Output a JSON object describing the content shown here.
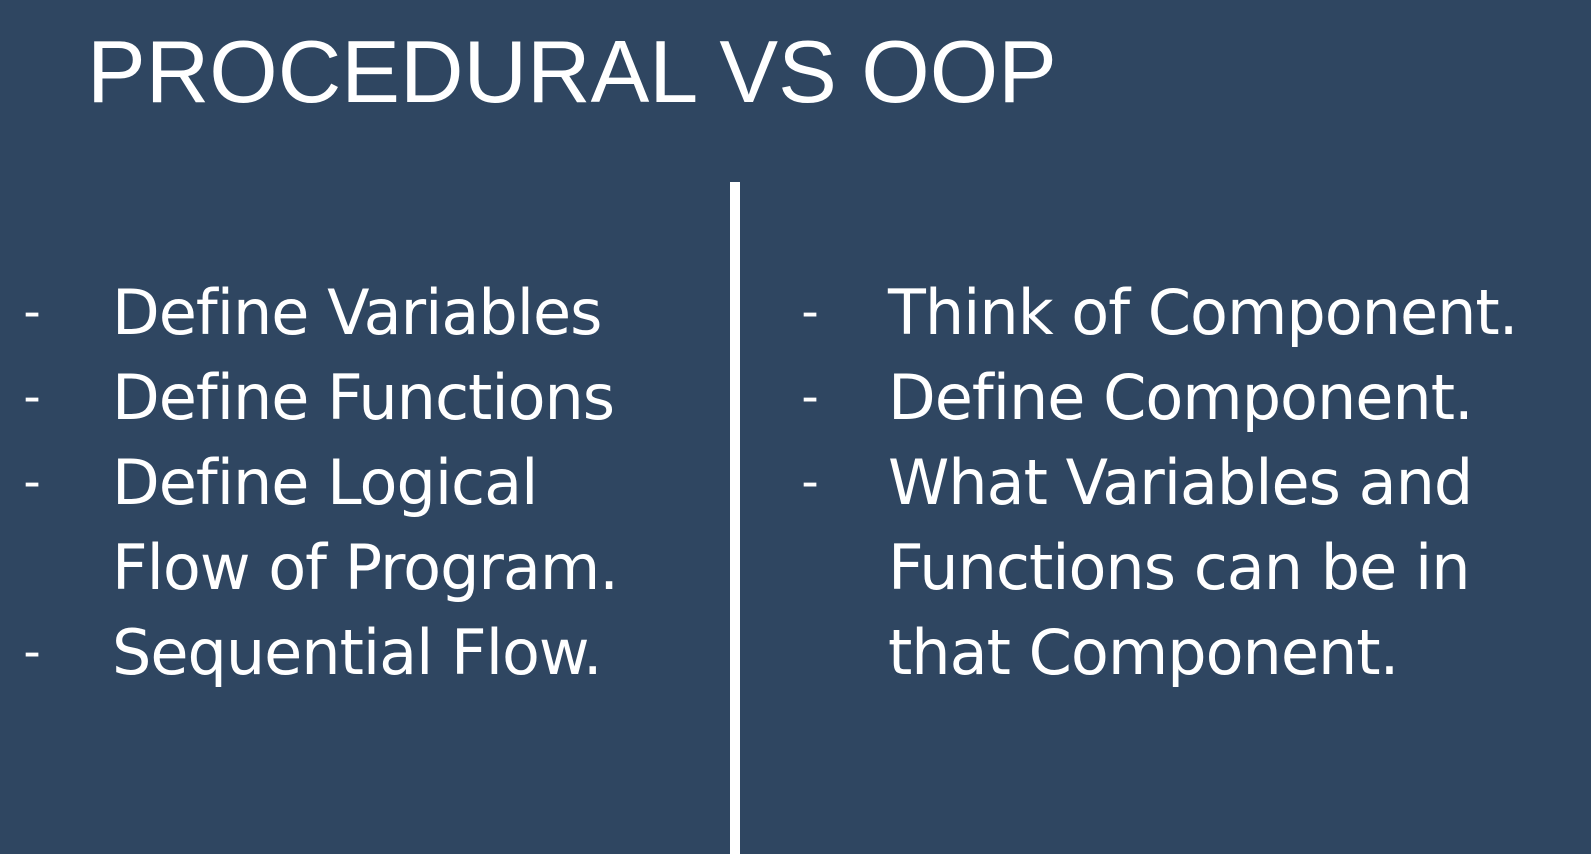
{
  "slide": {
    "title": "PROCEDURAL VS OOP",
    "bullet_marker": "-",
    "left_column": {
      "items": [
        {
          "lines": [
            "Define Variables"
          ]
        },
        {
          "lines": [
            "Define Functions"
          ]
        },
        {
          "lines": [
            "Define Logical",
            "Flow of Program."
          ]
        },
        {
          "lines": [
            "Sequential Flow."
          ]
        }
      ]
    },
    "right_column": {
      "items": [
        {
          "lines": [
            "Think of Component."
          ]
        },
        {
          "lines": [
            "Define Component."
          ]
        },
        {
          "lines": [
            "What Variables and",
            "Functions can be in",
            "that Component."
          ]
        }
      ]
    }
  },
  "colors": {
    "background": "#2f4661",
    "text": "#ffffff",
    "divider": "#ffffff"
  }
}
